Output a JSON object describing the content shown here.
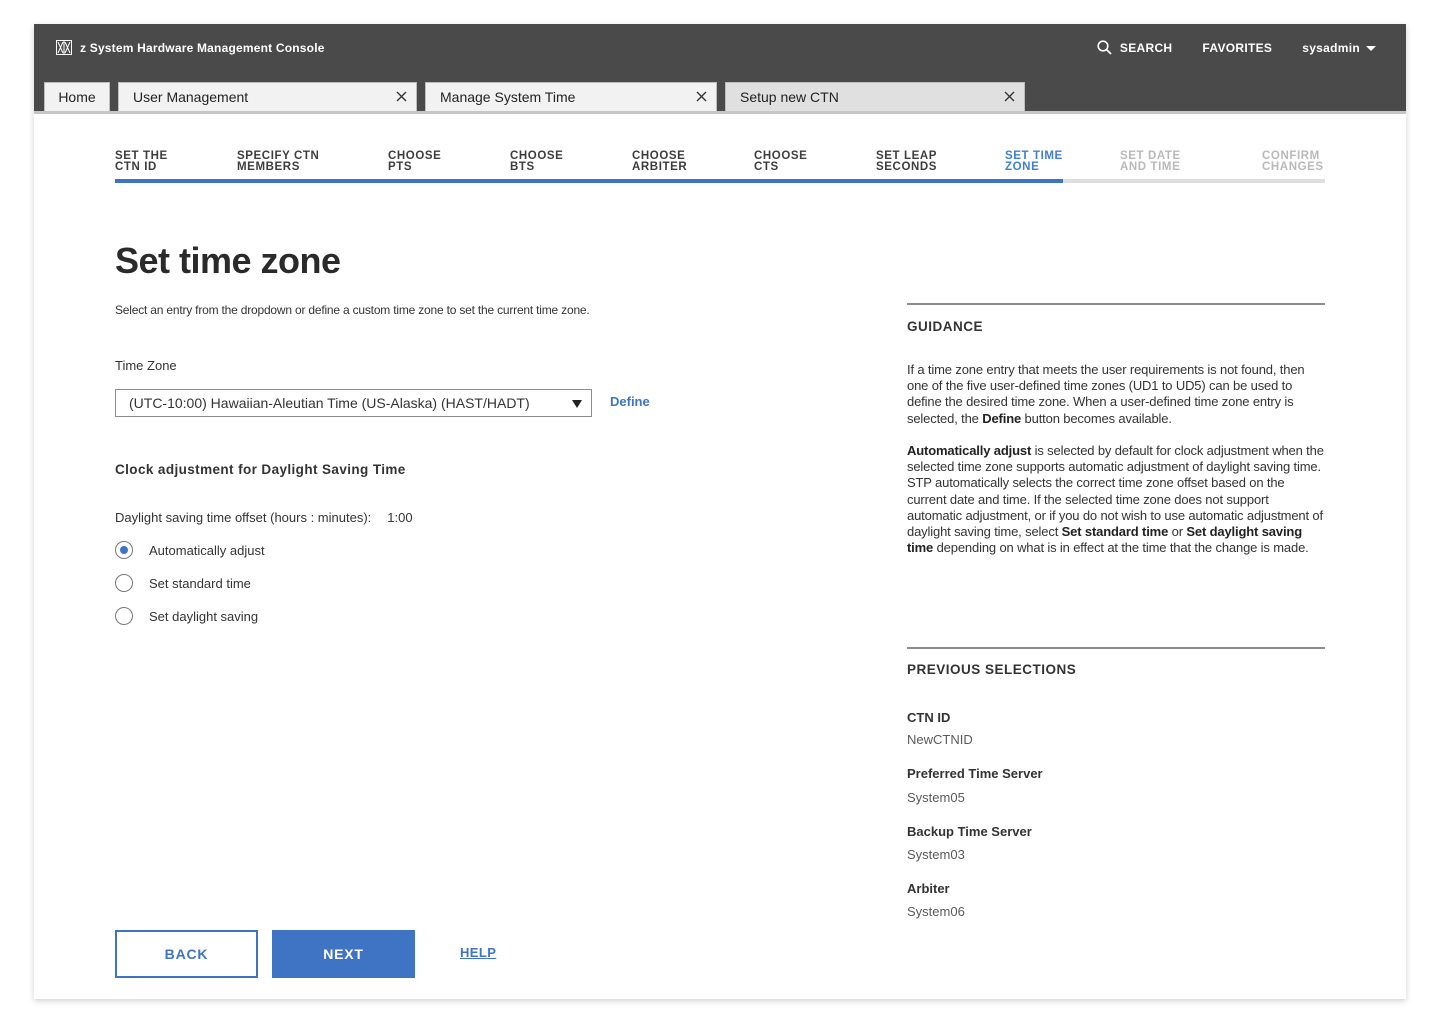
{
  "app": {
    "title": "z System Hardware Management Console",
    "logo_icon": "hmc-logo-icon"
  },
  "header": {
    "search_label": "SEARCH",
    "favorites_label": "FAVORITES",
    "user_label": "sysadmin"
  },
  "tabs": [
    {
      "label": "Home",
      "closable": false
    },
    {
      "label": "User Management",
      "closable": true
    },
    {
      "label": "Manage System Time",
      "closable": true
    },
    {
      "label": "Setup new CTN",
      "closable": true,
      "active": true
    }
  ],
  "wizard": {
    "steps": [
      {
        "label": "SET THE\nCTN ID",
        "state": "done"
      },
      {
        "label": "SPECIFY CTN\nMEMBERS",
        "state": "done"
      },
      {
        "label": "CHOOSE\nPTS",
        "state": "done"
      },
      {
        "label": "CHOOSE\nBTS",
        "state": "done"
      },
      {
        "label": "CHOOSE\nARBITER",
        "state": "done"
      },
      {
        "label": "CHOOSE\nCTS",
        "state": "done"
      },
      {
        "label": "SET LEAP\nSECONDS",
        "state": "done"
      },
      {
        "label": "SET TIME\nZONE",
        "state": "active"
      },
      {
        "label": "SET DATE\nAND TIME",
        "state": "future"
      },
      {
        "label": "CONFIRM\nCHANGES",
        "state": "future"
      }
    ],
    "current_step": 8,
    "total_steps": 10
  },
  "main": {
    "title": "Set time zone",
    "subtitle": "Select an entry from the dropdown or define a custom time zone to set the current time zone.",
    "timezone_label": "Time Zone",
    "timezone_value": "(UTC-10:00) Hawaiian-Aleutian Time (US-Alaska) (HAST/HADT)",
    "define_label": "Define",
    "dst_heading": "Clock adjustment for Daylight Saving Time",
    "offset_label": "Daylight saving time offset (hours : minutes):",
    "offset_value": "1:00",
    "radios": [
      {
        "label": "Automatically adjust",
        "checked": true
      },
      {
        "label": "Set standard time",
        "checked": false
      },
      {
        "label": "Set daylight saving",
        "checked": false
      }
    ]
  },
  "guidance": {
    "heading": "GUIDANCE",
    "p1_a": "If a time zone entry that meets the user requirements is not found, then one of the five user-defined time zones (UD1 to UD5) can be used to define the desired time zone. When a user-defined time zone entry is selected, the ",
    "p1_b": "Define",
    "p1_c": " button becomes available.",
    "p2_a": "Automatically adjust",
    "p2_b": " is selected by default for clock adjustment when the selected time zone supports automatic adjustment of daylight saving time. STP automatically selects the correct time zone offset based on the current date and time. If the selected time zone does not support automatic adjustment, or if you do not wish to use automatic adjustment of daylight saving time, select ",
    "p2_c": "Set standard time",
    "p2_d": " or ",
    "p2_e": "Set daylight saving time",
    "p2_f": " depending on what is in effect at the time that the change is made."
  },
  "previous": {
    "heading": "PREVIOUS SELECTIONS",
    "items": [
      {
        "label": "CTN ID",
        "value": "NewCTNID"
      },
      {
        "label": "Preferred Time Server",
        "value": "System05"
      },
      {
        "label": "Backup Time Server",
        "value": "System03"
      },
      {
        "label": "Arbiter",
        "value": "System06"
      }
    ]
  },
  "footer": {
    "back_label": "BACK",
    "next_label": "NEXT",
    "help_label": "HELP"
  },
  "colors": {
    "accent": "#3f74c4",
    "topbar": "#4a4a4a"
  }
}
